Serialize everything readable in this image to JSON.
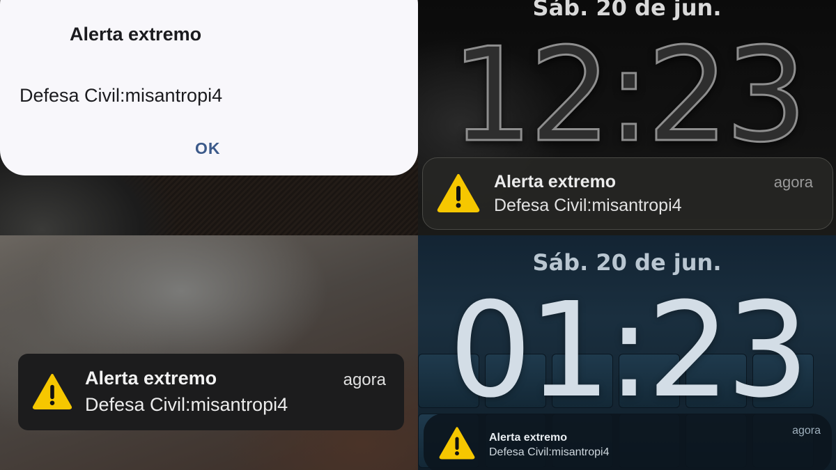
{
  "android_dialog": {
    "title": "Alerta extremo",
    "body": "Defesa Civil:misantropi4",
    "ok_label": "OK",
    "ok_color": "#3c5a8a"
  },
  "lockscreen_top": {
    "date": "Sáb. 20 de jun.",
    "time": "12:23",
    "notification": {
      "icon": "warning-triangle-icon",
      "title": "Alerta extremo",
      "body": "Defesa Civil:misantropi4",
      "time": "agora"
    }
  },
  "banner_bottom_left": {
    "notification": {
      "icon": "warning-triangle-icon",
      "title": "Alerta extremo",
      "body": "Defesa Civil:misantropi4",
      "time": "agora"
    }
  },
  "lockscreen_bottom": {
    "date": "Sáb. 20 de jun.",
    "time": "01:23",
    "notification": {
      "icon": "warning-triangle-icon",
      "title": "Alerta extremo",
      "body": "Defesa Civil:misantropi4",
      "time": "agora"
    }
  },
  "colors": {
    "warning_yellow": "#f6c700",
    "dialog_background": "#f8f7fb"
  }
}
